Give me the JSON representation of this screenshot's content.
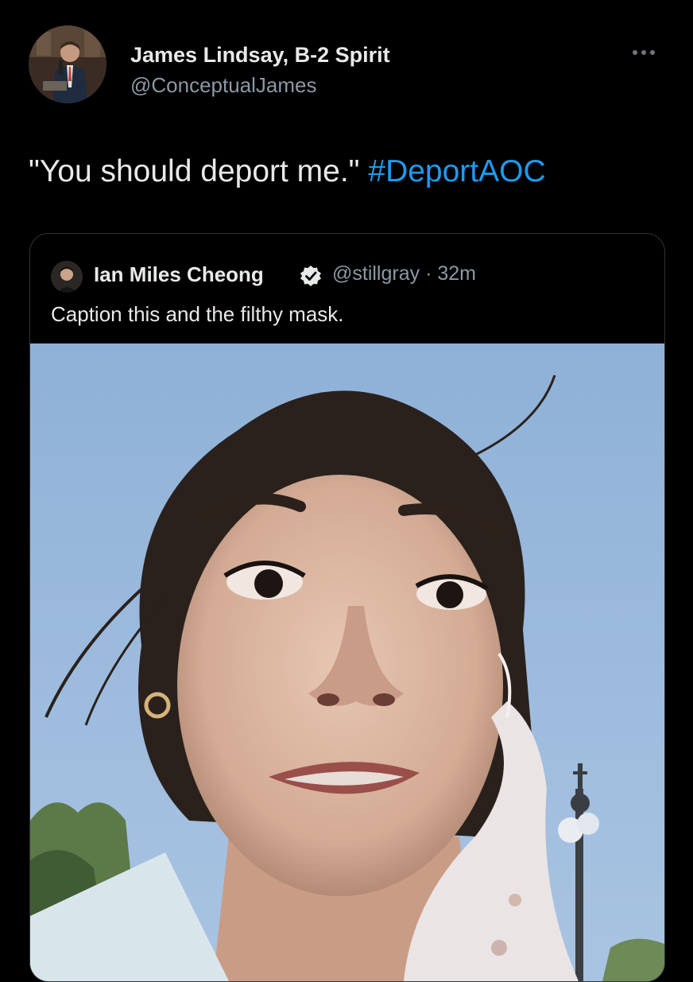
{
  "tweet": {
    "author_name": "James Lindsay, B-2 Spirit",
    "author_handle": "@ConceptualJames",
    "text_quote": "\"You should deport me.\"",
    "hashtag": "#DeportAOC"
  },
  "quoted_tweet": {
    "author_name": "Ian Miles Cheong",
    "author_handle": "@stillgray",
    "separator": "·",
    "time": "32m",
    "text": "Caption this and the filthy mask."
  },
  "colors": {
    "background": "#000000",
    "text": "#e7e9ea",
    "secondary": "#8b98a5",
    "link": "#1d9bf0",
    "border": "#2f3336"
  },
  "icons": {
    "more": "more-horizontal-icon",
    "verified": "verified-badge-icon"
  }
}
